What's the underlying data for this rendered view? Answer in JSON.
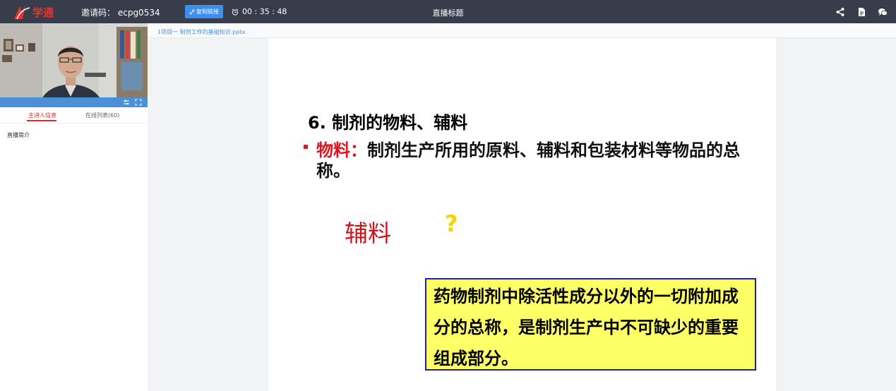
{
  "header": {
    "invite_label": "邀请码：",
    "invite_code": "ecpg0534",
    "copy_link_label": "复制链接",
    "timer": "00 : 35 : 48",
    "title": "直播标题",
    "icons": [
      "share-icon",
      "document-icon",
      "chat-icon"
    ]
  },
  "sidebar": {
    "tabs": [
      {
        "label": "主讲人信息",
        "active": true
      },
      {
        "label": "在线列表(60)",
        "active": false
      }
    ],
    "intro_label": "直播简介"
  },
  "file": {
    "name": "1项目一 制剂工作的基础知识.pptx"
  },
  "slide": {
    "heading": "6. 制剂的物料、辅料",
    "bullet_term": "物料：",
    "bullet_text": "制剂生产所用的原料、辅料和包装材料等物品的总称。",
    "fuliao": "辅料",
    "question_mark": "?",
    "definition": "药物制剂中除活性成分以外的一切附加成分的总称，是制剂生产中不可缺少的重要组成部分。"
  },
  "colors": {
    "topbar": "#383d4c",
    "accent": "#3c8ff0",
    "tab_active": "#e02a2a",
    "slide_red": "#e0141e",
    "box_fill": "#ffff66",
    "box_border": "#1b1bd0"
  }
}
